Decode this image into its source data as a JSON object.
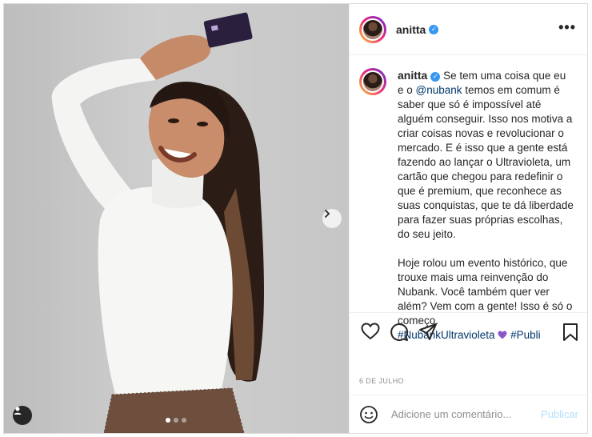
{
  "post": {
    "username": "anitta",
    "verified_glyph": "✓",
    "more_label": "•••",
    "caption_username": "anitta",
    "caption_part1": "Se tem uma coisa que eu e o",
    "mention": "@nubank",
    "caption_part2": "temos em comum é saber que só é impossível até alguém conseguir. Isso nos motiva a criar coisas novas e revolucionar o mercado. E é isso que a gente está fazendo ao lançar o Ultravioleta, um cartão que chegou para redefinir o que é premium, que reconhece as suas conquistas, que te dá liberdade para fazer suas próprias escolhas, do seu jeito.",
    "caption_part3": "Hoje rolou um evento histórico, que trouxe mais uma reinvenção do Nubank. Você também quer ver além? Vem com a gente! Isso é só o começo.",
    "hashtag1": "#NubankUltravioleta",
    "hashtag2": "#Publi",
    "date": "6 DE JULHO",
    "comment_placeholder": "Adicione um comentário...",
    "publish_label": "Publicar",
    "carousel": {
      "count": 3,
      "active_index": 0
    }
  },
  "icons": [
    "heart-icon",
    "comment-icon",
    "share-icon",
    "bookmark-icon",
    "emoji-icon",
    "chevron-right-icon",
    "user-tag-icon",
    "more-icon",
    "verified-icon"
  ],
  "colors": {
    "verified": "#3897f0",
    "link": "#00376b",
    "publish": "#b2dffc",
    "purple_heart": "#8a56c9"
  }
}
